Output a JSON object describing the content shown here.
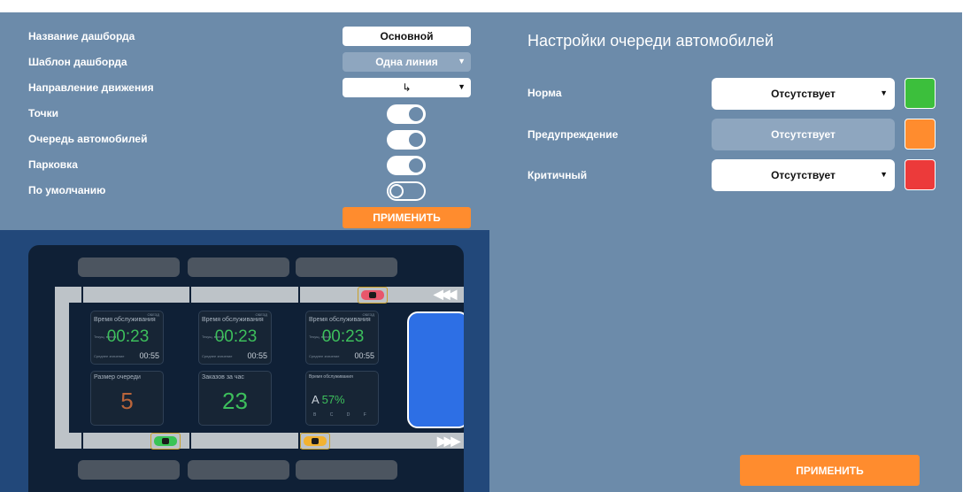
{
  "dashboard_settings": {
    "name_label": "Название дашборда",
    "name_value": "Основной",
    "template_label": "Шаблон дашборда",
    "template_value": "Одна линия",
    "direction_label": "Направление движения",
    "direction_value": "↳",
    "points_label": "Точки",
    "points_on": true,
    "queue_label": "Очередь автомобилей",
    "queue_on": true,
    "parking_label": "Парковка",
    "parking_on": true,
    "default_label": "По умолчанию",
    "default_on": false,
    "apply_label": "ПРИМЕНИТЬ"
  },
  "preview": {
    "arrows_top": "◀◀◀",
    "arrows_bottom": "▶▶▶",
    "service_cards": [
      {
        "title": "Время обслуживания",
        "tag": "ОБЕЗД",
        "time": "00:23",
        "sub": "00:55",
        "fine_top": "Текущ. время",
        "fine_bottom": "Среднее значение"
      },
      {
        "title": "Время обслуживания",
        "tag": "ОБЕЗД",
        "time": "00:23",
        "sub": "00:55",
        "fine_top": "Текущ. время",
        "fine_bottom": "Среднее значение"
      },
      {
        "title": "Время обслуживания",
        "tag": "ОБЕЗД",
        "time": "00:23",
        "sub": "00:55",
        "fine_top": "Текущ. время",
        "fine_bottom": "Среднее значение"
      }
    ],
    "queue_card": {
      "title": "Размер очереди",
      "value": "5"
    },
    "orders_card": {
      "title": "Заказов за час",
      "value": "23"
    },
    "grade_card": {
      "title": "Время обслуживания",
      "grade": "A",
      "percent": "57%",
      "grades_row": "B C D F"
    },
    "colors": {
      "queue_value": "#b9643a",
      "orders_value": "#3dbf5c",
      "car_red": "#e8566b",
      "car_green": "#39c455",
      "car_yellow": "#f2b230"
    }
  },
  "queue_settings": {
    "title": "Настройки очереди автомобилей",
    "levels": [
      {
        "label": "Норма",
        "value": "Отсутствует",
        "enabled": true,
        "color": "#3cbf3c"
      },
      {
        "label": "Предупреждение",
        "value": "Отсутствует",
        "enabled": false,
        "color": "#ff8c2e"
      },
      {
        "label": "Критичный",
        "value": "Отсутствует",
        "enabled": true,
        "color": "#ec3a3a"
      }
    ],
    "apply_label": "ПРИМЕНИТЬ"
  }
}
